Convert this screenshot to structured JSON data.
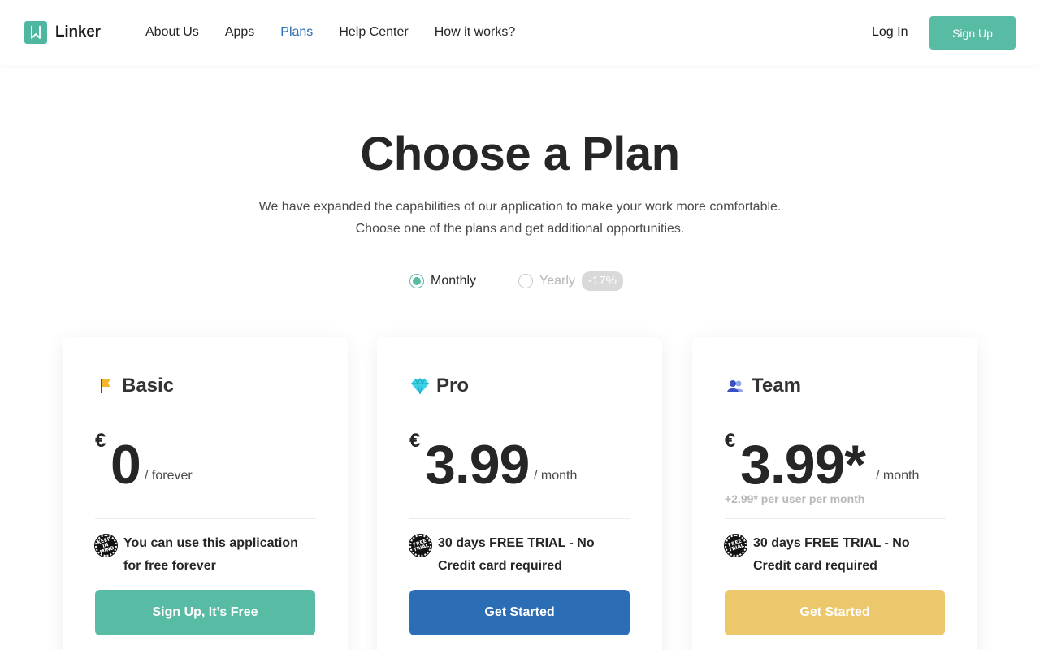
{
  "brand": {
    "name": "Linker",
    "accent": "#58bba3",
    "logo_icon": "bookmark-icon"
  },
  "nav": {
    "items": [
      {
        "label": "About Us",
        "active": false
      },
      {
        "label": "Apps",
        "active": false
      },
      {
        "label": "Plans",
        "active": true
      },
      {
        "label": "Help Center",
        "active": false
      },
      {
        "label": "How it works?",
        "active": false
      }
    ],
    "active_color": "#2c6eb5"
  },
  "auth": {
    "login_label": "Log In",
    "signup_label": "Sign Up"
  },
  "hero": {
    "title": "Choose a Plan",
    "subtitle_line1": "We have expanded the capabilities of our application to make your work more comfortable.",
    "subtitle_line2": "Choose one of the plans and get additional opportunities."
  },
  "billing": {
    "options": [
      {
        "label": "Monthly",
        "selected": true
      },
      {
        "label": "Yearly",
        "selected": false,
        "badge": "-17%"
      }
    ]
  },
  "plans": [
    {
      "name": "Basic",
      "icon": "flag-icon",
      "currency": "€",
      "amount": "0",
      "period": "/ forever",
      "extra": "",
      "feature_icon": "keep-in-mind-sticker-icon",
      "feature": "You can use this application for free forever",
      "cta": "Sign Up, It’s Free",
      "cta_color": "#58bba3"
    },
    {
      "name": "Pro",
      "icon": "gem-icon",
      "currency": "€",
      "amount": "3.99",
      "period": "/ month",
      "extra": "",
      "feature_icon": "free-trial-sticker-icon",
      "feature": "30 days FREE TRIAL - No Credit card required",
      "cta": "Get Started",
      "cta_color": "#2c6eb5"
    },
    {
      "name": "Team",
      "icon": "users-icon",
      "currency": "€",
      "amount": "3.99*",
      "period": "/ month",
      "extra": "+2.99* per user per month",
      "feature_icon": "free-trial-sticker-icon",
      "feature": "30 days FREE TRIAL - No Credit card required",
      "cta": "Get Started",
      "cta_color": "#ecc76b"
    }
  ]
}
